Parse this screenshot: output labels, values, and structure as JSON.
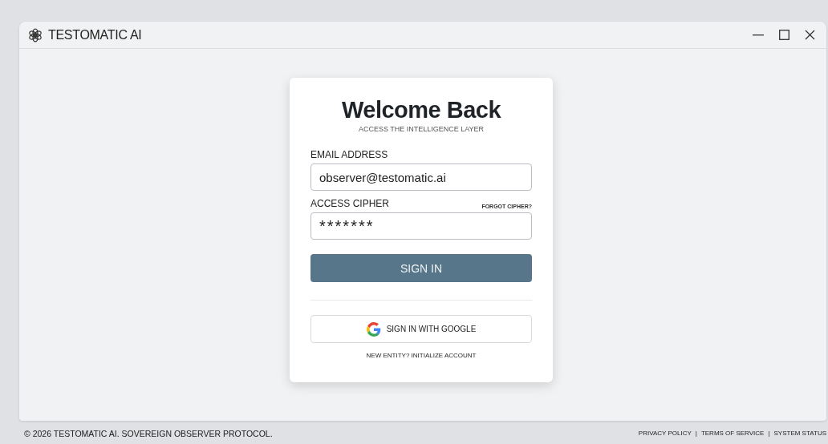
{
  "window": {
    "title": "TESTOMATIC AI"
  },
  "card": {
    "heading": "Welcome Back",
    "subheading": "ACCESS THE INTELLIGENCE LAYER",
    "fields": [
      {
        "label": "EMAIL ADDRESS",
        "value": "observer@testomatic.ai"
      },
      {
        "label": "ACCESS CIPHER",
        "value": "*******",
        "link": "FORGOT CIPHER?"
      }
    ],
    "primary_button": "SIGN IN",
    "google_button": "SIGN IN WITH GOOGLE",
    "signup_link": "NEW ENTITY? INITIALIZE ACCOUNT"
  },
  "footer": {
    "copyright": "© 2026 TESTOMATIC AI. SOVEREIGN OBSERVER PROTOCOL.",
    "separator": "|",
    "links": [
      "PRIVACY POLICY",
      "TERMS OF SERVICE",
      "SYSTEM STATUS"
    ]
  }
}
